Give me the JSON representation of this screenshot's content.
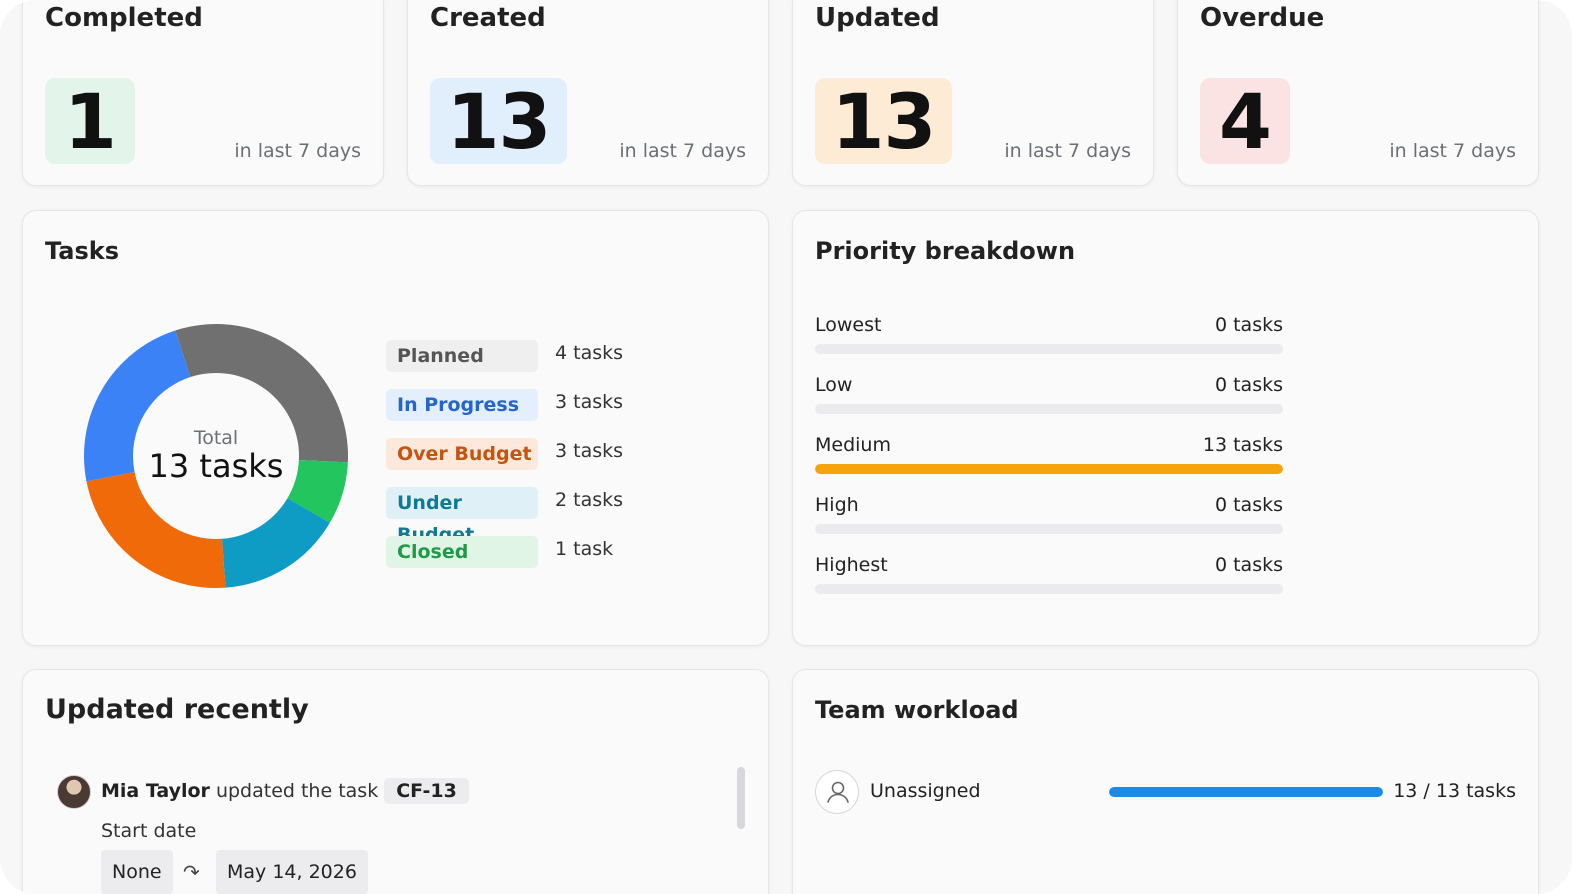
{
  "colors": {
    "completed_bg": "#e3f4ea",
    "created_bg": "#e0effb",
    "updated_bg": "#fdebd6",
    "overdue_bg": "#fbe3e4",
    "priority_fill": "#f5a30f",
    "workload_fill": "#1a8ae8"
  },
  "stats": [
    {
      "title": "Completed",
      "value": "1",
      "subtitle": "in last 7 days"
    },
    {
      "title": "Created",
      "value": "13",
      "subtitle": "in last 7 days"
    },
    {
      "title": "Updated",
      "value": "13",
      "subtitle": "in last 7 days"
    },
    {
      "title": "Overdue",
      "value": "4",
      "subtitle": "in last 7 days"
    }
  ],
  "tasks": {
    "title": "Tasks",
    "total_label": "Total",
    "total_value": "13 tasks",
    "legend": [
      {
        "label": "Planned",
        "count": "4 tasks",
        "pill_bg": "#efefef",
        "pill_color": "#555555"
      },
      {
        "label": "In Progress",
        "count": "3 tasks",
        "pill_bg": "#e3effd",
        "pill_color": "#2566c8"
      },
      {
        "label": "Over Budget",
        "count": "3 tasks",
        "pill_bg": "#fde9dc",
        "pill_color": "#c4540e"
      },
      {
        "label": "Under Budget",
        "count": "2 tasks",
        "pill_bg": "#dff1f6",
        "pill_color": "#0e7a94"
      },
      {
        "label": "Closed",
        "count": "1 task",
        "pill_bg": "#e1f5e7",
        "pill_color": "#1f9a46"
      }
    ]
  },
  "chart_data": {
    "type": "pie",
    "title": "Tasks",
    "categories": [
      "Planned",
      "Closed",
      "Under Budget",
      "Over Budget",
      "In Progress"
    ],
    "values": [
      4,
      1,
      2,
      3,
      3
    ],
    "colors": [
      "#707070",
      "#22c55e",
      "#0e9bc4",
      "#f06a0a",
      "#3b82f6"
    ],
    "total": 13
  },
  "priority": {
    "title": "Priority breakdown",
    "rows": [
      {
        "label": "Lowest",
        "count": "0 tasks",
        "fraction": 0
      },
      {
        "label": "Low",
        "count": "0 tasks",
        "fraction": 0
      },
      {
        "label": "Medium",
        "count": "13 tasks",
        "fraction": 1
      },
      {
        "label": "High",
        "count": "0 tasks",
        "fraction": 0
      },
      {
        "label": "Highest",
        "count": "0 tasks",
        "fraction": 0
      }
    ]
  },
  "recent": {
    "title": "Updated recently",
    "user": "Mia Taylor",
    "action": "updated the task",
    "task_key": "CF-13",
    "field": "Start date",
    "old_value": "None",
    "new_value": "May 14, 2026",
    "arrow_glyph": "↷"
  },
  "workload": {
    "title": "Team workload",
    "label": "Unassigned",
    "count": "13 / 13 tasks",
    "fraction": 1
  }
}
